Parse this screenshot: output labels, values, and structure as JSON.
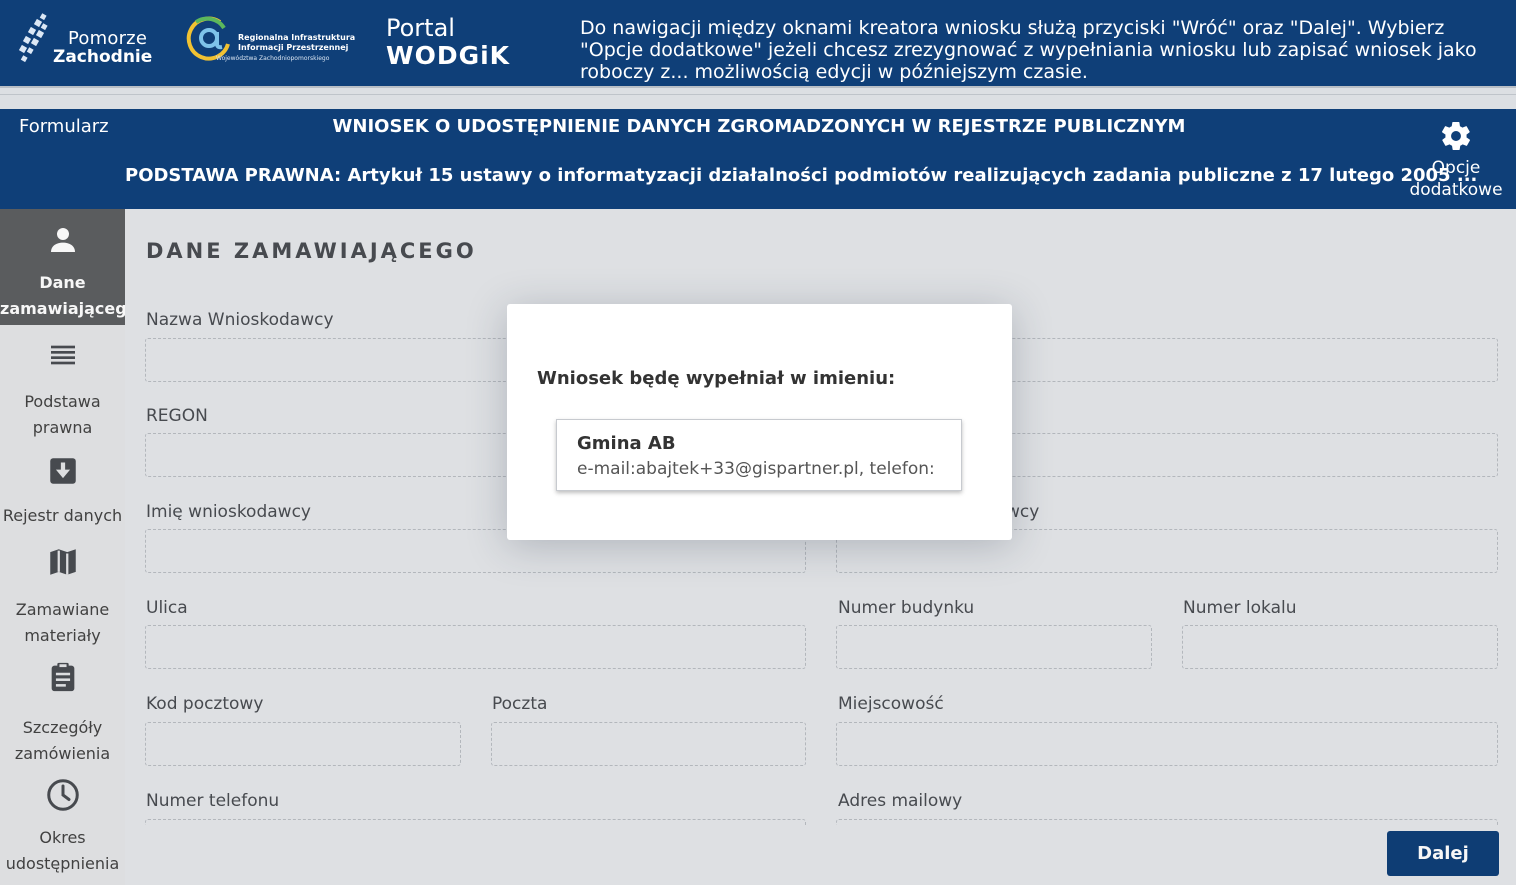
{
  "header": {
    "logo1_line1": "Pomorze",
    "logo1_line2": "Zachodnie",
    "logo2_line1": "Regionalna Infrastruktura",
    "logo2_line2": "Informacji Przestrzennej",
    "logo2_line3": "Województwa Zachodniopomorskiego",
    "portal_line1": "Portal",
    "portal_line2": "WODGiK",
    "nav_hint": "Do nawigacji między oknami kreatora wniosku służą przyciski \"Wróć\" oraz \"Dalej\". Wybierz \"Opcje dodatkowe\" jeżeli chcesz zrezygnować z wypełniania wniosku lub zapisać wniosek jako roboczy z... możliwością edycji w późniejszym czasie."
  },
  "form_header": {
    "label": "Formularz",
    "title": "WNIOSEK O UDOSTĘPNIENIE DANYCH ZGROMADZONYCH W REJESTRZE PUBLICZNYM",
    "legal_basis": "PODSTAWA PRAWNA: Artykuł 15 ustawy o informatyzacji działalności podmiotów realizujących zadania publiczne z 17 lutego 2005 ...",
    "options_line1": "Opcje",
    "options_line2": "dodatkowe"
  },
  "sidebar": {
    "items": [
      {
        "line1": "Dane",
        "line2": "zamawiającego"
      },
      {
        "line1": "Podstawa",
        "line2": "prawna"
      },
      {
        "line1": "Rejestr danych",
        "line2": ""
      },
      {
        "line1": "Zamawiane",
        "line2": "materiały"
      },
      {
        "line1": "Szczegóły",
        "line2": "zamówienia"
      },
      {
        "line1": "Okres",
        "line2": "udostępnienia"
      }
    ]
  },
  "main": {
    "section_title": "DANE ZAMAWIAJĄCEGO",
    "labels": {
      "applicant_name": "Nazwa Wnioskodawcy",
      "regon": "REGON",
      "first_name": "Imię wnioskodawcy",
      "last_name_partial": "wcy",
      "street": "Ulica",
      "building_no": "Numer budynku",
      "unit_no": "Numer lokalu",
      "postal_code": "Kod pocztowy",
      "post_office": "Poczta",
      "city": "Miejscowość",
      "phone": "Numer telefonu",
      "email": "Adres mailowy"
    },
    "next_label": "Dalej"
  },
  "modal": {
    "title": "Wniosek będę wypełniał w imieniu:",
    "applicant": {
      "name": "Gmina AB",
      "contact": "e-mail:abajtek+33@gispartner.pl, telefon:"
    }
  },
  "colors": {
    "brand_blue": "#0f3f78",
    "sidebar_active": "#5d5f62",
    "background": "#e6e8eb"
  }
}
